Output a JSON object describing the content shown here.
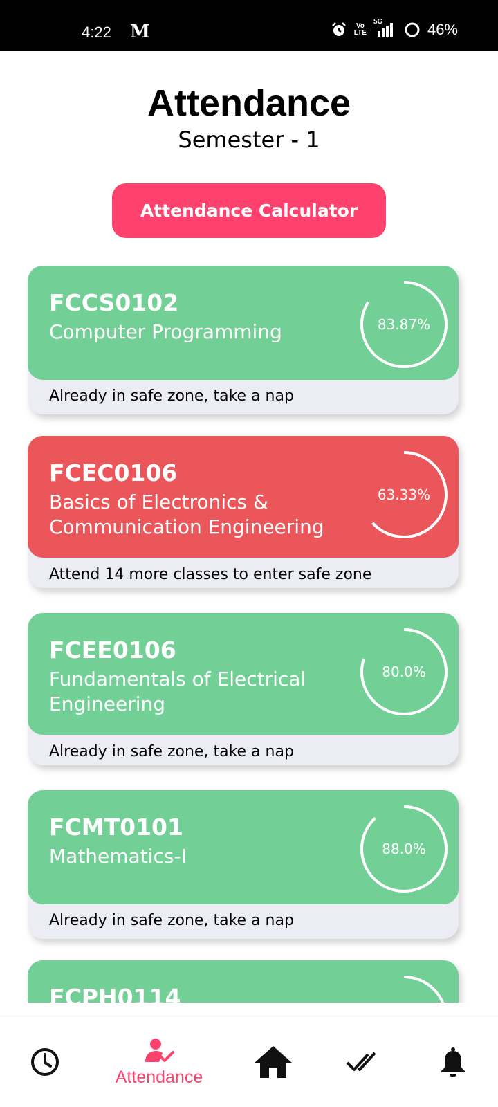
{
  "status_bar": {
    "time": "4:22",
    "carrier_icon_text": "M",
    "volte_top": "Vo",
    "volte_bottom": "LTE",
    "network": "5G",
    "battery": "46%"
  },
  "header": {
    "title": "Attendance",
    "subtitle": "Semester - 1"
  },
  "calculator_button": "Attendance Calculator",
  "colors": {
    "accent": "#fe416d",
    "safe": "#72cf96",
    "danger": "#ea5659",
    "footer": "#ecedf4"
  },
  "courses": [
    {
      "code": "FCCS0102",
      "name": "Computer Programming",
      "percent_text": "83.87%",
      "percent": 83.87,
      "status": "safe",
      "message": "Already in safe zone, take a nap"
    },
    {
      "code": "FCEC0106",
      "name": "Basics of Electronics & Communication Engineering",
      "percent_text": "63.33%",
      "percent": 63.33,
      "status": "danger",
      "message": "Attend 14 more classes to enter safe zone"
    },
    {
      "code": "FCEE0106",
      "name": "Fundamentals of Electrical Engineering",
      "percent_text": "80.0%",
      "percent": 80.0,
      "status": "safe",
      "message": "Already in safe zone, take a nap"
    },
    {
      "code": "FCMT0101",
      "name": "Mathematics-I",
      "percent_text": "88.0%",
      "percent": 88.0,
      "status": "safe",
      "message": "Already in safe zone, take a nap"
    },
    {
      "code": "FCPH0114",
      "status": "safe"
    }
  ],
  "bottom_nav": {
    "items": [
      {
        "icon": "clock-icon"
      },
      {
        "icon": "attendance-icon",
        "label": "Attendance",
        "active": true
      },
      {
        "icon": "home-icon"
      },
      {
        "icon": "double-check-icon"
      },
      {
        "icon": "bell-icon"
      }
    ]
  }
}
